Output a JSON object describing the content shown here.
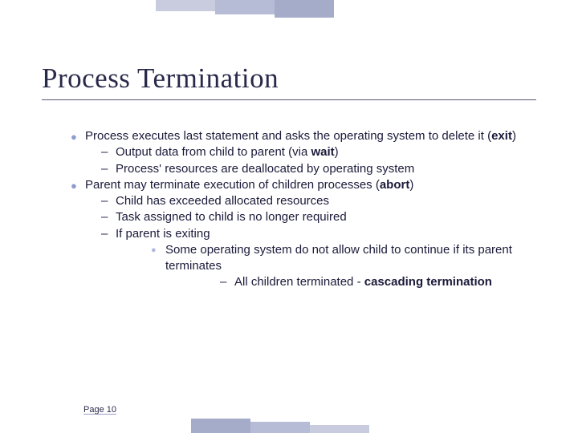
{
  "title": "Process Termination",
  "page_label": "Page 10",
  "bullets": [
    {
      "pre": "Process executes last statement and asks the operating system to delete it (",
      "bold": "exit",
      "post": ")",
      "subs": [
        {
          "pre": "Output data from child to parent (via ",
          "bold": "wait",
          "post": ")"
        },
        {
          "pre": "Process' resources are deallocated by operating system",
          "bold": "",
          "post": ""
        }
      ]
    },
    {
      "pre": "Parent may terminate execution of children processes (",
      "bold": "abort",
      "post": ")",
      "subs": [
        {
          "pre": "Child has exceeded allocated resources",
          "bold": "",
          "post": ""
        },
        {
          "pre": "Task assigned to child is no longer required",
          "bold": "",
          "post": ""
        },
        {
          "pre": "If parent is exiting",
          "bold": "",
          "post": "",
          "subs": [
            {
              "pre": "Some operating system do not allow child to continue if its parent terminates",
              "bold": "",
              "post": "",
              "subs": [
                {
                  "pre": "All children terminated - ",
                  "bold": "cascading termination",
                  "post": ""
                }
              ]
            }
          ]
        }
      ]
    }
  ],
  "strip_colors": {
    "a": "#c9ccdf",
    "b": "#b6bbd6",
    "c": "#a5acc9"
  }
}
